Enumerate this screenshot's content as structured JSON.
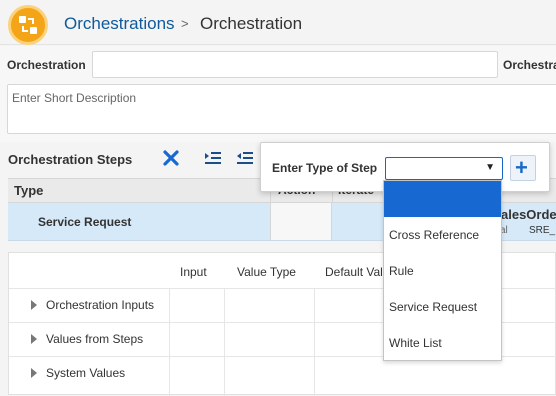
{
  "header": {
    "icon_name": "orchestration-app-icon",
    "breadcrumb_parent": "Orchestrations",
    "breadcrumb_separator": ">",
    "breadcrumb_current": "Orchestration"
  },
  "form": {
    "orchestration_label": "Orchestration",
    "orchestration_value": "",
    "second_label": "Orchestra",
    "description_placeholder": "Enter Short Description"
  },
  "steps": {
    "title": "Orchestration Steps",
    "toolbar_icons": [
      "delete-x-icon",
      "indent-icon",
      "outdent-icon"
    ],
    "columns": {
      "type": "Type",
      "action_partial": "Action",
      "iterate_partial": "Iterate"
    },
    "rows": [
      {
        "name": "Service Request",
        "peek_title": "alesOrde",
        "peek_sub1": "al",
        "peek_sub2": "SRE_"
      }
    ]
  },
  "lower": {
    "columns": [
      "Input",
      "Value Type",
      "Default Val"
    ],
    "rows": [
      "Orchestration Inputs",
      "Values from Steps",
      "System Values"
    ]
  },
  "popup": {
    "label": "Enter Type of Step",
    "select_value": "",
    "caret": "▼",
    "add_label": "+"
  },
  "dropdown": {
    "options": [
      "",
      "Cross Reference",
      "Rule",
      "Service Request",
      "White List"
    ],
    "selected_index": 0
  },
  "colors": {
    "accent_blue": "#1769d1",
    "link_blue": "#0e5a9c",
    "app_icon_orange": "#f4a417",
    "row_selected": "#d6e9f8"
  }
}
